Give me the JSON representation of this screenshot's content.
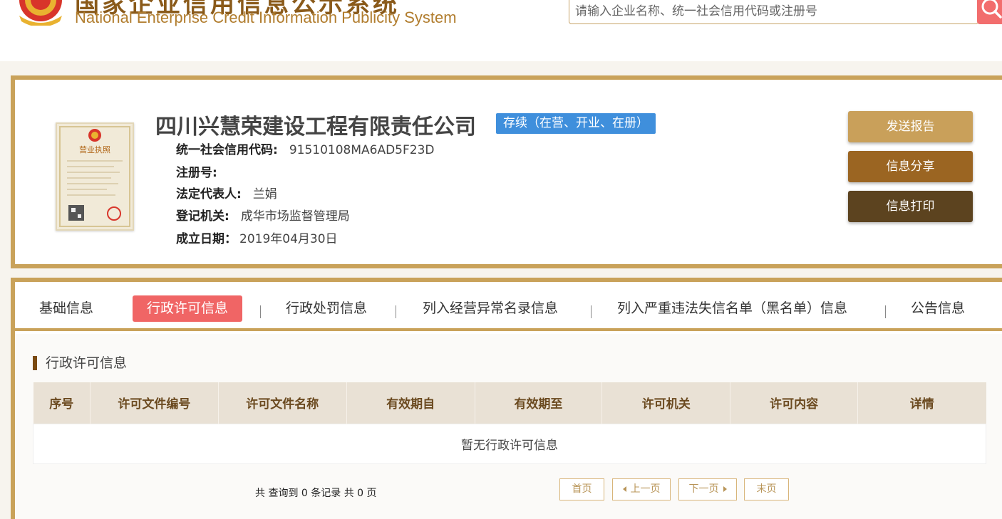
{
  "header": {
    "title_cn": "国家企业信用信息公示系统",
    "title_en": "National Enterprise Credit Information Publicity System",
    "search_placeholder": "请输入企业名称、统一社会信用代码或注册号"
  },
  "company": {
    "name": "四川兴慧荣建设工程有限责任公司",
    "status": "存续（在营、开业、在册）",
    "license_title": "营业执照",
    "fields": [
      {
        "label": "统一社会信用代码:",
        "value": "91510108MA6AD5F23D"
      },
      {
        "label": "注册号:",
        "value": ""
      },
      {
        "label": "法定代表人:",
        "value": "兰娟"
      },
      {
        "label": "登记机关:",
        "value": "成华市场监督管理局"
      },
      {
        "label": "成立日期：",
        "value": "2019年04月30日"
      }
    ],
    "actions": {
      "send": "发送报告",
      "share": "信息分享",
      "print": "信息打印"
    }
  },
  "tabs": [
    {
      "label": "基础信息"
    },
    {
      "label": "行政许可信息"
    },
    {
      "label": "行政处罚信息"
    },
    {
      "label": "列入经营异常名录信息"
    },
    {
      "label": "列入严重违法失信名单（黑名单）信息"
    },
    {
      "label": "公告信息"
    }
  ],
  "section": {
    "title": "行政许可信息",
    "columns": [
      "序号",
      "许可文件编号",
      "许可文件名称",
      "有效期自",
      "有效期至",
      "许可机关",
      "许可内容",
      "详情"
    ],
    "empty_text": "暂无行政许可信息"
  },
  "pager": {
    "summary": "共 查询到 0 条记录 共 0 页",
    "first": "首页",
    "prev": "上一页",
    "next": "下一页",
    "last": "末页"
  },
  "colors": {
    "gold_border": "#c9a25a",
    "active_tab": "#f06565",
    "status_blue": "#3f8fdc"
  }
}
